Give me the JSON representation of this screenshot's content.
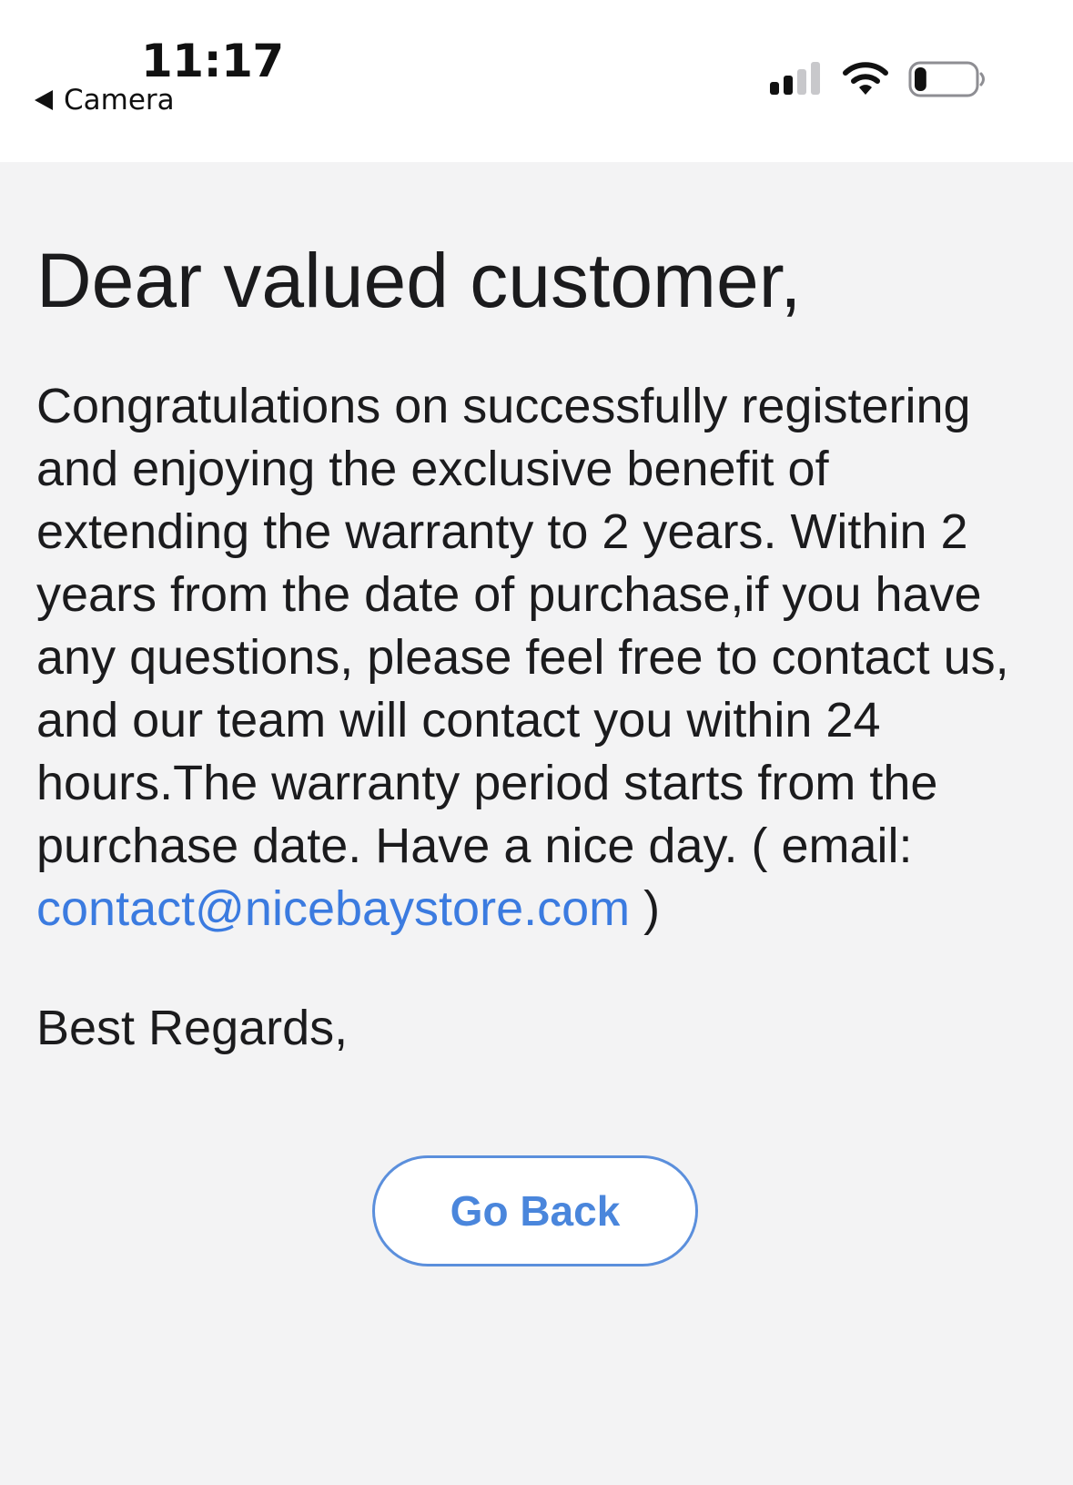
{
  "status_bar": {
    "time": "11:17",
    "back_app_label": "Camera",
    "icons": [
      "back-arrow-icon",
      "cellular-signal-icon",
      "wifi-icon",
      "battery-icon"
    ],
    "signal_bars_filled": 2,
    "signal_bars_total": 4,
    "battery_level": 0.2
  },
  "message": {
    "greeting": "Dear valued customer,",
    "body": "Congratulations on successfully registering and enjoying the exclusive benefit of extending the warranty to 2 years. Within 2 years from the date of purchase,if you have any questions, please feel free to contact us, and our team will contact you within 24 hours.The warranty period starts from the purchase date. Have a nice day. ( email: ",
    "email": "contact@nicebaystore.com",
    "body_end": " )",
    "signoff": "Best Regards,"
  },
  "actions": {
    "go_back_label": "Go Back"
  },
  "colors": {
    "background": "#f3f3f4",
    "status_bar_background": "#ffffff",
    "link": "#3b7be0",
    "button_border": "#5b8fdc",
    "text": "#1b1b1d"
  }
}
